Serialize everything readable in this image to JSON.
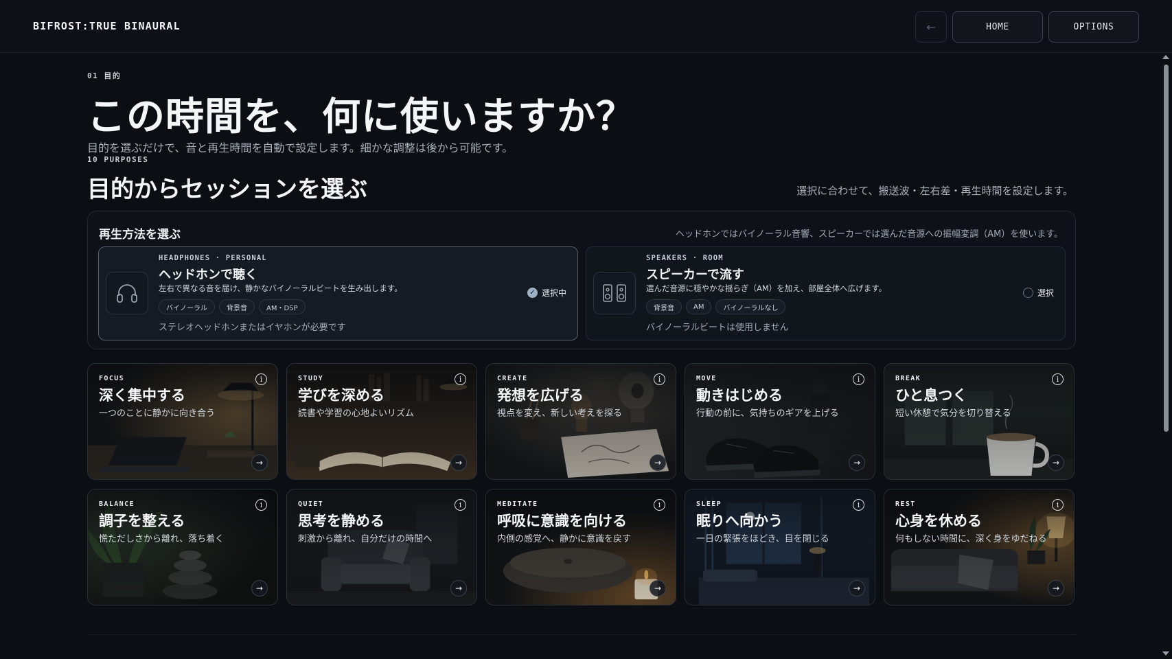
{
  "app": {
    "brand": "BIFROST:TRUE BINAURAL"
  },
  "nav": {
    "back_label": "←",
    "home_label": "HOME",
    "options_label": "OPTIONS"
  },
  "intro": {
    "step": "01 目的",
    "title": "この時間を、何に使いますか？",
    "lead": "目的を選ぶだけで、音と再生時間を自動で設定します。細かな調整は後から可能です。"
  },
  "section": {
    "eyebrow": "10 PURPOSES",
    "title": "目的からセッションを選ぶ",
    "note": "選択に合わせて、搬送波・左右差・再生時間を設定します。"
  },
  "playback": {
    "title": "再生方法を選ぶ",
    "note": "ヘッドホンではバイノーラル音響、スピーカーでは選んだ音源への振幅変調（AM）を使います。",
    "modes": [
      {
        "tag": "HEADPHONES · PERSONAL",
        "title": "ヘッドホンで聴く",
        "desc": "左右で異なる音を届け、静かなバイノーラルビートを生み出します。",
        "chips": [
          "バイノーラル",
          "背景音",
          "AM・DSP"
        ],
        "foot": "ステレオヘッドホンまたはイヤホンが必要です",
        "state": "選択中",
        "selected": true,
        "icon": "headphones-icon"
      },
      {
        "tag": "SPEAKERS · ROOM",
        "title": "スピーカーで流す",
        "desc": "選んだ音源に穏やかな揺らぎ（AM）を加え、部屋全体へ広げます。",
        "chips": [
          "背景音",
          "AM",
          "バイノーラルなし"
        ],
        "foot": "バイノーラルビートは使用しません",
        "state": "選択",
        "selected": false,
        "icon": "speakers-icon"
      }
    ]
  },
  "purposes": [
    {
      "tag": "FOCUS",
      "title": "深く集中する",
      "desc": "一つのことに静かに向き合う",
      "scene": "desk-lamp-laptop"
    },
    {
      "tag": "STUDY",
      "title": "学びを深める",
      "desc": "読書や学習の心地よいリズム",
      "scene": "open-book-library"
    },
    {
      "tag": "CREATE",
      "title": "発想を広げる",
      "desc": "視点を変え、新しい考えを探る",
      "scene": "sketchbook-sculpture"
    },
    {
      "tag": "MOVE",
      "title": "動きはじめる",
      "desc": "行動の前に、気持ちのギアを上げる",
      "scene": "sneakers-bottle"
    },
    {
      "tag": "BREAK",
      "title": "ひと息つく",
      "desc": "短い休憩で気分を切り替える",
      "scene": "coffee-cup-window"
    },
    {
      "tag": "BALANCE",
      "title": "調子を整える",
      "desc": "慌ただしさから離れ、落ち着く",
      "scene": "stacked-stones-plant"
    },
    {
      "tag": "QUIET",
      "title": "思考を静める",
      "desc": "刺激から離れ、自分だけの時間へ",
      "scene": "armchair-room"
    },
    {
      "tag": "MEDITATE",
      "title": "呼吸に意識を向ける",
      "desc": "内側の感覚へ、静かに意識を戻す",
      "scene": "cushion-candle"
    },
    {
      "tag": "SLEEP",
      "title": "眠りへ向かう",
      "desc": "一日の緊張をほどき、目を閉じる",
      "scene": "bed-moonlight"
    },
    {
      "tag": "REST",
      "title": "心身を休める",
      "desc": "何もしない時間に、深く身をゆだねる",
      "scene": "sofa-lamp"
    }
  ],
  "colors": {
    "background": "#0b0e13",
    "accent": "#9fb2c6"
  }
}
